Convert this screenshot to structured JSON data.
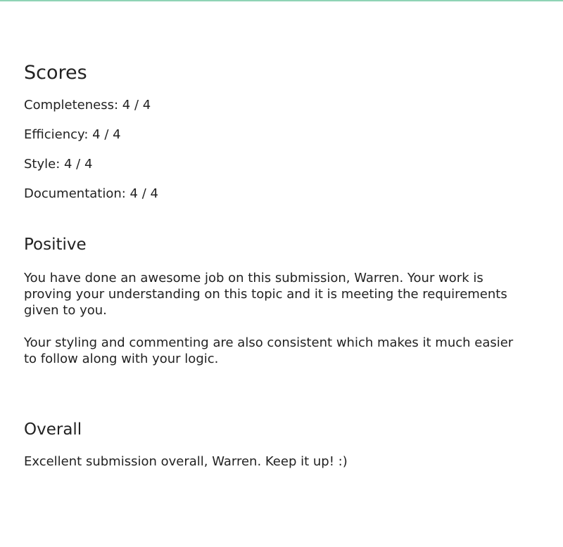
{
  "scores": {
    "heading": "Scores",
    "items": [
      {
        "label": "Completeness: 4 / 4"
      },
      {
        "label": "Efficiency: 4 / 4"
      },
      {
        "label": "Style: 4 / 4"
      },
      {
        "label": "Documentation: 4 / 4"
      }
    ]
  },
  "positive": {
    "heading": "Positive",
    "paragraphs": [
      "You have done an awesome job on this submission, Warren. Your work is proving your understanding on this topic and it is meeting the requirements given to you.",
      "Your styling and commenting are also consistent which makes it much easier to follow along with your logic."
    ]
  },
  "overall": {
    "heading": "Overall",
    "text": "Excellent submission overall, Warren. Keep it up! :)"
  },
  "colors": {
    "top_rule": "#8fd3b5",
    "text": "#222222",
    "background": "#ffffff"
  }
}
